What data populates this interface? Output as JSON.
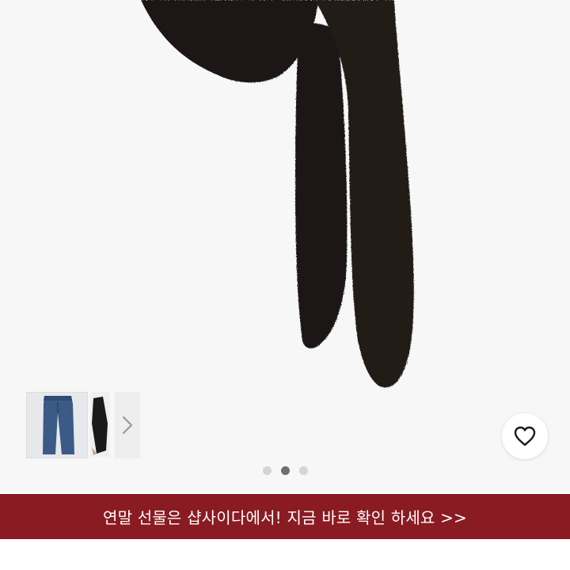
{
  "product_image": {
    "subject": "black fuzzy knit bow tie",
    "background_color": "#f7f7f7",
    "item_color": "#1c1715"
  },
  "thumbnails": {
    "items": [
      {
        "icon": "denim-jeans-thumbnail"
      },
      {
        "icon": "black-item-thumbnail"
      }
    ],
    "next_icon": "chevron-right-icon"
  },
  "wishlist": {
    "icon": "heart-icon"
  },
  "pager": {
    "count": 3,
    "active_index": 1,
    "active_color": "#6f6f6f",
    "inactive_color": "#d4d4d4"
  },
  "promo_banner": {
    "text": "연말 선물은 샵사이다에서! 지금 바로 확인 하세요 >>",
    "background": "#8a1b22",
    "text_color": "#ffffff"
  }
}
